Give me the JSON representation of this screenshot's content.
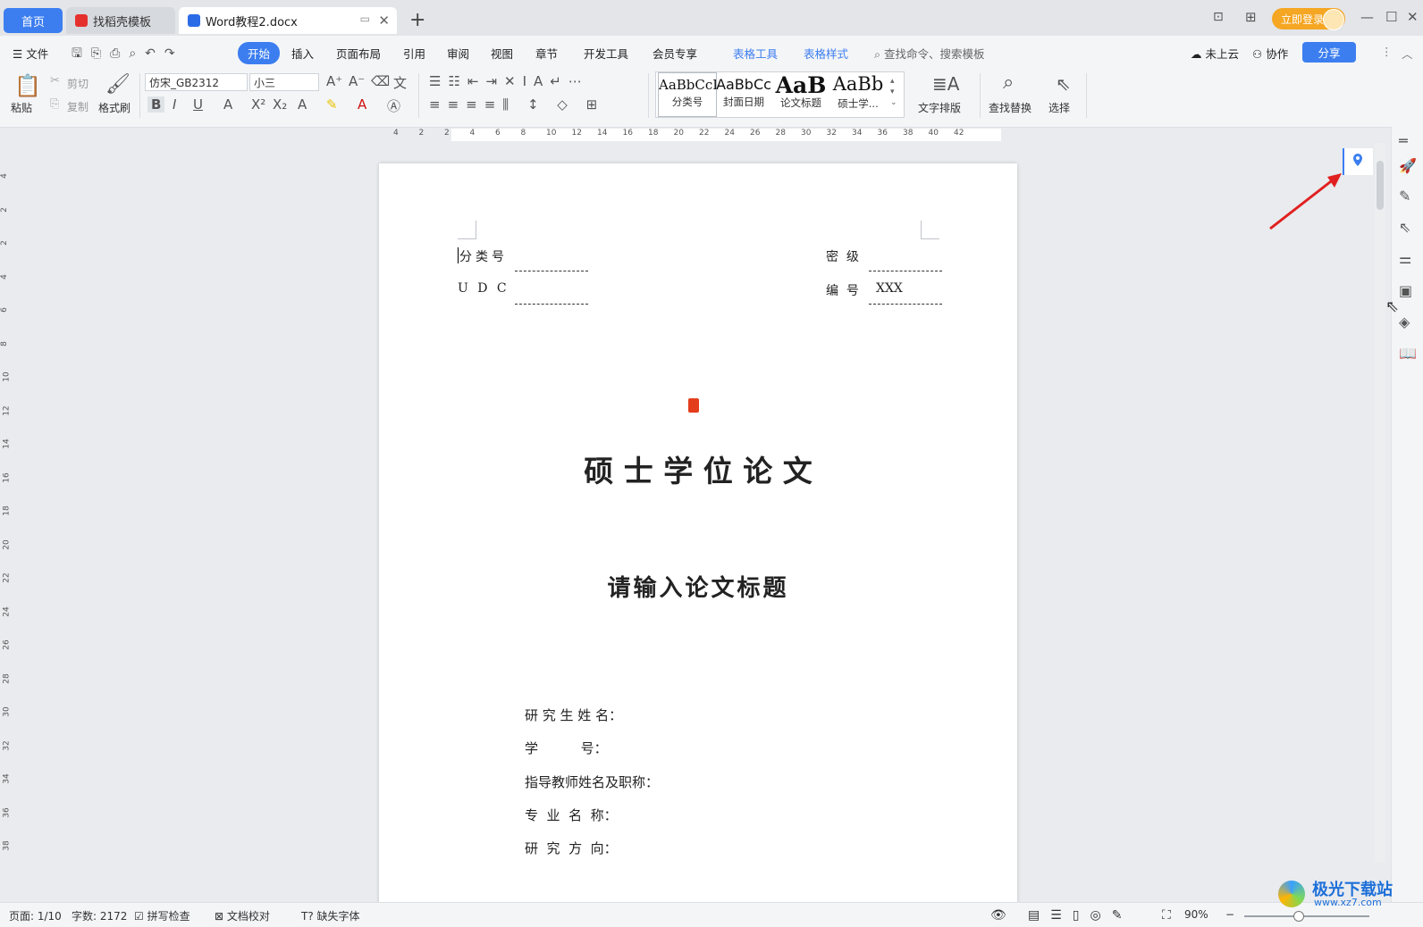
{
  "tabs": {
    "home": "首页",
    "template": "找稻壳模板",
    "document": "Word教程2.docx",
    "new_tab": "+"
  },
  "titlebar": {
    "login": "立即登录"
  },
  "menu": {
    "file": "文件",
    "items": [
      "开始",
      "插入",
      "页面布局",
      "引用",
      "审阅",
      "视图",
      "章节",
      "开发工具",
      "会员专享",
      "表格工具",
      "表格样式"
    ],
    "search_placeholder": "查找命令、搜索模板",
    "cloud": "未上云",
    "collab": "协作",
    "share": "分享"
  },
  "ribbon": {
    "paste": "粘贴",
    "cut": "剪切",
    "copy": "复制",
    "format_painter": "格式刷",
    "font_name": "仿宋_GB2312",
    "font_size": "小三",
    "styles": [
      {
        "sample": "AaBbCcI",
        "name": "分类号"
      },
      {
        "sample": "AaBbCc",
        "name": "封面日期"
      },
      {
        "sample": "AaB",
        "name": "论文标题"
      },
      {
        "sample": "AaBb",
        "name": "硕士学..."
      }
    ],
    "text_layout": "文字排版",
    "find_replace": "查找替换",
    "select": "选择"
  },
  "ruler": {
    "h_ticks": [
      "4",
      "2",
      "2",
      "4",
      "6",
      "8",
      "10",
      "12",
      "14",
      "16",
      "18",
      "20",
      "22",
      "24",
      "26",
      "28",
      "30",
      "32",
      "34",
      "36",
      "38",
      "40",
      "42"
    ],
    "v_ticks": [
      "4",
      "2",
      "2",
      "4",
      "6",
      "8",
      "10",
      "12",
      "14",
      "16",
      "18",
      "20",
      "22",
      "24",
      "26",
      "28",
      "30",
      "32",
      "34",
      "36",
      "38"
    ]
  },
  "document": {
    "class_no_label": "分类号",
    "udc_label": "U D C",
    "secret_label": "密  级",
    "number_label": "编  号",
    "number_value": "XXX",
    "degree_title": "硕 士 学 位 论 文",
    "thesis_title": "请输入论文标题",
    "fields": [
      "研 究 生 姓 名：",
      "学          号：",
      "指导教师姓名及职称：",
      "专  业  名  称：",
      "研  究  方  向："
    ]
  },
  "status": {
    "page": "页面: 1/10",
    "words": "字数: 2172",
    "spell": "拼写检查",
    "proof": "文档校对",
    "missing_font": "缺失字体",
    "zoom": "90%"
  },
  "watermark": {
    "name": "极光下载站",
    "url": "www.xz7.com"
  },
  "colors": {
    "accent": "#3c7ef0",
    "login": "#f5a623",
    "arrow": "#e02020"
  }
}
